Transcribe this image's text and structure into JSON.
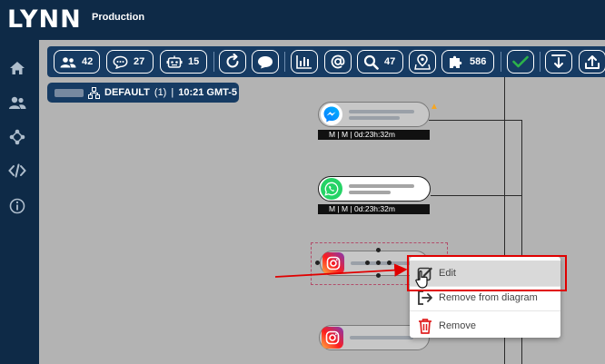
{
  "app": {
    "logo": "LYNN",
    "environment": "Production"
  },
  "sidebar": {
    "items": [
      {
        "icon": "home-icon"
      },
      {
        "icon": "users-icon"
      },
      {
        "icon": "flow-icon"
      },
      {
        "icon": "code-icon"
      },
      {
        "icon": "info-icon"
      }
    ]
  },
  "toolbar": {
    "users_count": "42",
    "chats_count": "27",
    "bots_count": "15",
    "search_count": "47",
    "plugins_count": "586"
  },
  "status": {
    "default_label": "DEFAULT",
    "count": "(1)",
    "separator": "|",
    "time": "10:21 GMT-5"
  },
  "nodes": [
    {
      "channel": "messenger-icon",
      "caption": "M | M | 0d:23h:32m"
    },
    {
      "channel": "whatsapp-icon",
      "caption": "M | M | 0d:23h:32m"
    },
    {
      "channel": "instagram-icon",
      "caption": ""
    },
    {
      "channel": "instagram-icon",
      "caption": ""
    }
  ],
  "context_menu": {
    "edit": "Edit",
    "remove_from_diagram": "Remove from diagram",
    "remove": "Remove"
  },
  "colors": {
    "navy": "#0e2a47",
    "toolbar": "#163b63",
    "accent_green": "#2db34a",
    "annotation_red": "#e00000",
    "warning": "#f5a623"
  }
}
